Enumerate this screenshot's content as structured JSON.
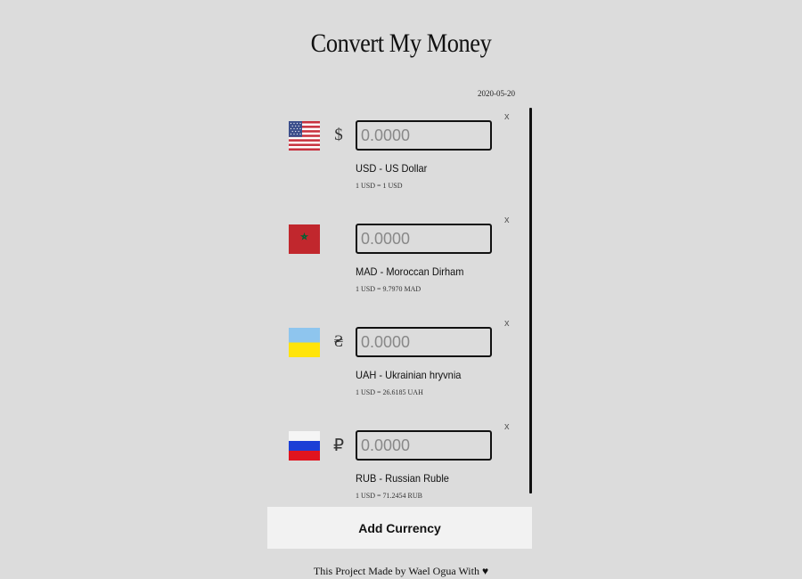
{
  "app": {
    "title": "Convert My Money",
    "date": "2020-05-20"
  },
  "currencies": [
    {
      "flag": "us-flag-icon",
      "symbol": "$",
      "placeholder": "0.0000",
      "name": "USD - US Dollar",
      "rate": "1 USD = 1 USD",
      "remove_label": "x"
    },
    {
      "flag": "morocco-flag-icon",
      "symbol": "",
      "placeholder": "0.0000",
      "name": "MAD - Moroccan Dirham",
      "rate": "1 USD = 9.7970 MAD",
      "remove_label": "x"
    },
    {
      "flag": "ukraine-flag-icon",
      "symbol": "₴",
      "placeholder": "0.0000",
      "name": "UAH - Ukrainian hryvnia",
      "rate": "1 USD = 26.6185 UAH",
      "remove_label": "x"
    },
    {
      "flag": "russia-flag-icon",
      "symbol": "₽",
      "placeholder": "0.0000",
      "name": "RUB - Russian Ruble",
      "rate": "1 USD = 71.2454 RUB",
      "remove_label": "x"
    }
  ],
  "actions": {
    "add_currency_label": "Add Currency"
  },
  "footer": {
    "text": "This Project Made by Wael Ogua With ♥"
  },
  "colors": {
    "background": "#dcdcdc",
    "button_background": "#f2f2f2"
  }
}
